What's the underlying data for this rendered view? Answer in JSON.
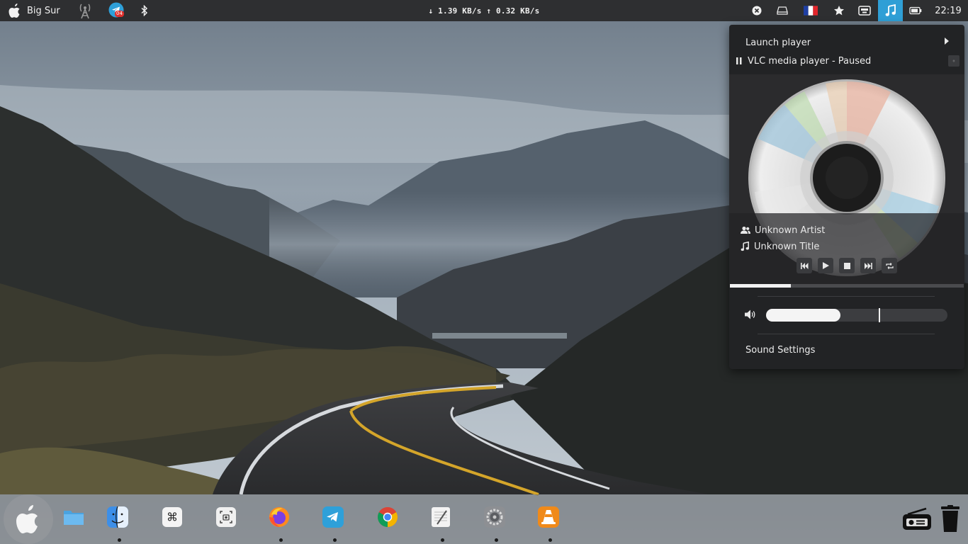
{
  "topbar": {
    "menu_title": "Big Sur",
    "telegram_badge": "04",
    "net_speed": "↓ 1.39 KB/s ↑ 0.32 KB/s",
    "clock": "22:19",
    "icons": [
      "apple-icon",
      "antenna-icon",
      "telegram-icon",
      "bluetooth-icon",
      "close-circle-icon",
      "drive-icon",
      "french-flag-icon",
      "star-icon",
      "keyboard-icon",
      "music-note-icon",
      "battery-icon"
    ]
  },
  "player": {
    "launch_label": "Launch player",
    "vlc_title": "VLC media player - Paused",
    "close_glyph": "◦",
    "artist": "Unknown Artist",
    "title": "Unknown Title",
    "progress": 0.26,
    "controls": [
      "previous-icon",
      "play-icon",
      "stop-icon",
      "next-icon",
      "repeat-icon"
    ]
  },
  "volume": {
    "level": 0.41,
    "max_marker": 0.62
  },
  "menu": {
    "sound_settings": "Sound Settings"
  },
  "dock": {
    "items": [
      "apple-launcher",
      "files",
      "finder",
      "command-key",
      "screenshot",
      "firefox",
      "telegram",
      "chrome",
      "text-editor",
      "system-preferences",
      "vlc",
      "radio",
      "trash"
    ]
  },
  "colors": {
    "accent": "#2f9fd6",
    "panel": "#2e2f31",
    "popup": "#222325"
  }
}
